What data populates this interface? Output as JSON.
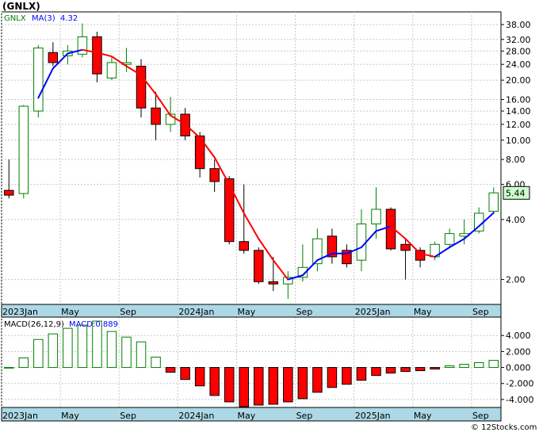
{
  "ticker_title": "(GNLX)",
  "watermark": "© 12Stocks.com",
  "colors": {
    "up": "#ffffff",
    "up_stroke": "#008000",
    "down": "#ff0000",
    "down_stroke": "#000000",
    "ma_up": "#0000ff",
    "ma_down": "#ff0000",
    "axis_band": "#add8e6",
    "macd_pos": "#008000",
    "macd_neg": "#ff0000",
    "last_label_bg": "#ccffcc",
    "grid": "#c8c8c8"
  },
  "chart_data": [
    {
      "type": "candlestick",
      "title": "GNLX",
      "legend": {
        "symbol": "GNLX",
        "ma_label": "MA(3)",
        "ma_value": "4.32"
      },
      "y_scale": "log",
      "ylim": [
        1.5,
        44
      ],
      "y_ticks": [
        2.0,
        4.0,
        6.0,
        8.0,
        10.0,
        12.0,
        14.0,
        16.0,
        20.0,
        24.0,
        28.0,
        32.0,
        38.0
      ],
      "y_tick_labels": [
        "2.00",
        "4.00",
        "6.00",
        "8.00",
        "10.00",
        "12.00",
        "14.00",
        "16.00",
        "20.00",
        "24.00",
        "28.00",
        "32.00",
        "38.00"
      ],
      "x_tick_labels": [
        "2023Jan",
        "May",
        "Sep",
        "2024Jan",
        "May",
        "Sep",
        "2025Jan",
        "May",
        "Sep"
      ],
      "x_tick_index": [
        0,
        4,
        8,
        12,
        16,
        20,
        24,
        28,
        32
      ],
      "last_value_label": "5.44",
      "candles": [
        {
          "o": 5.6,
          "h": 8.0,
          "l": 5.1,
          "c": 5.3
        },
        {
          "o": 5.4,
          "h": 15.0,
          "l": 5.1,
          "c": 14.8
        },
        {
          "o": 14.0,
          "h": 30.0,
          "l": 13.0,
          "c": 29.0
        },
        {
          "o": 27.5,
          "h": 31.0,
          "l": 23.5,
          "c": 24.5
        },
        {
          "o": 26.5,
          "h": 30.0,
          "l": 24.0,
          "c": 28.0
        },
        {
          "o": 27.0,
          "h": 38.5,
          "l": 26.0,
          "c": 33.0
        },
        {
          "o": 33.0,
          "h": 35.0,
          "l": 19.5,
          "c": 21.5
        },
        {
          "o": 20.5,
          "h": 26.0,
          "l": 20.0,
          "c": 24.5
        },
        {
          "o": 24.0,
          "h": 29.0,
          "l": 22.0,
          "c": 24.5
        },
        {
          "o": 23.5,
          "h": 25.5,
          "l": 13.0,
          "c": 14.5
        },
        {
          "o": 14.5,
          "h": 17.5,
          "l": 10.0,
          "c": 12.0
        },
        {
          "o": 12.0,
          "h": 16.5,
          "l": 11.0,
          "c": 13.5
        },
        {
          "o": 13.5,
          "h": 14.5,
          "l": 10.0,
          "c": 10.5
        },
        {
          "o": 10.5,
          "h": 11.0,
          "l": 6.5,
          "c": 7.2
        },
        {
          "o": 7.2,
          "h": 8.0,
          "l": 5.5,
          "c": 6.2
        },
        {
          "o": 6.4,
          "h": 6.6,
          "l": 3.0,
          "c": 3.1
        },
        {
          "o": 3.1,
          "h": 6.0,
          "l": 2.7,
          "c": 2.8
        },
        {
          "o": 2.8,
          "h": 2.9,
          "l": 1.9,
          "c": 1.95
        },
        {
          "o": 1.95,
          "h": 2.6,
          "l": 1.75,
          "c": 1.9
        },
        {
          "o": 1.9,
          "h": 2.2,
          "l": 1.6,
          "c": 2.05
        },
        {
          "o": 2.05,
          "h": 3.0,
          "l": 1.95,
          "c": 2.3
        },
        {
          "o": 2.4,
          "h": 3.6,
          "l": 2.2,
          "c": 3.2
        },
        {
          "o": 3.3,
          "h": 3.6,
          "l": 2.4,
          "c": 2.6
        },
        {
          "o": 2.8,
          "h": 3.0,
          "l": 2.3,
          "c": 2.4
        },
        {
          "o": 2.5,
          "h": 4.5,
          "l": 2.2,
          "c": 3.8
        },
        {
          "o": 3.8,
          "h": 5.8,
          "l": 3.2,
          "c": 4.5
        },
        {
          "o": 4.5,
          "h": 4.6,
          "l": 2.8,
          "c": 2.85
        },
        {
          "o": 3.0,
          "h": 3.2,
          "l": 2.0,
          "c": 2.8
        },
        {
          "o": 2.8,
          "h": 2.9,
          "l": 2.3,
          "c": 2.5
        },
        {
          "o": 2.6,
          "h": 3.1,
          "l": 2.5,
          "c": 3.0
        },
        {
          "o": 3.0,
          "h": 3.6,
          "l": 2.9,
          "c": 3.4
        },
        {
          "o": 3.3,
          "h": 4.0,
          "l": 3.0,
          "c": 3.4
        },
        {
          "o": 3.5,
          "h": 4.6,
          "l": 3.4,
          "c": 4.3
        },
        {
          "o": 4.4,
          "h": 5.8,
          "l": 4.3,
          "c": 5.44
        }
      ],
      "ma": [
        null,
        null,
        16.3,
        22.9,
        27.2,
        28.4,
        27.5,
        26.3,
        23.5,
        21.2,
        17.0,
        13.3,
        12.0,
        10.3,
        8.2,
        6.0,
        4.3,
        3.2,
        2.5,
        2.0,
        2.1,
        2.5,
        2.7,
        2.7,
        2.9,
        3.5,
        3.7,
        3.2,
        2.7,
        2.6,
        2.9,
        3.2,
        3.7,
        4.32
      ]
    },
    {
      "type": "bar",
      "title": "MACD(26,12,9)",
      "legend": {
        "params": "MACD(26,12,9)",
        "value_label": "MACD:0.889"
      },
      "ylim": [
        -5.0,
        6.3
      ],
      "y_ticks": [
        -4.0,
        -2.0,
        0.0,
        2.0,
        4.0
      ],
      "y_tick_labels": [
        "-4.000",
        "-2.000",
        "0.000",
        "2.000",
        "4.000"
      ],
      "x_tick_labels": [
        "2023Jan",
        "May",
        "Sep",
        "2024Jan",
        "May",
        "Sep",
        "2025Jan",
        "May",
        "Sep"
      ],
      "x_tick_index": [
        0,
        4,
        8,
        12,
        16,
        20,
        24,
        28,
        32
      ],
      "values": [
        0.0,
        1.2,
        3.5,
        4.2,
        4.9,
        5.3,
        5.8,
        4.5,
        3.8,
        3.2,
        1.3,
        -0.6,
        -1.5,
        -2.3,
        -3.5,
        -4.3,
        -4.9,
        -4.7,
        -4.6,
        -4.3,
        -3.9,
        -3.1,
        -2.5,
        -2.1,
        -1.6,
        -1.0,
        -0.7,
        -0.5,
        -0.4,
        -0.2,
        0.2,
        0.4,
        0.6,
        0.889
      ]
    }
  ]
}
